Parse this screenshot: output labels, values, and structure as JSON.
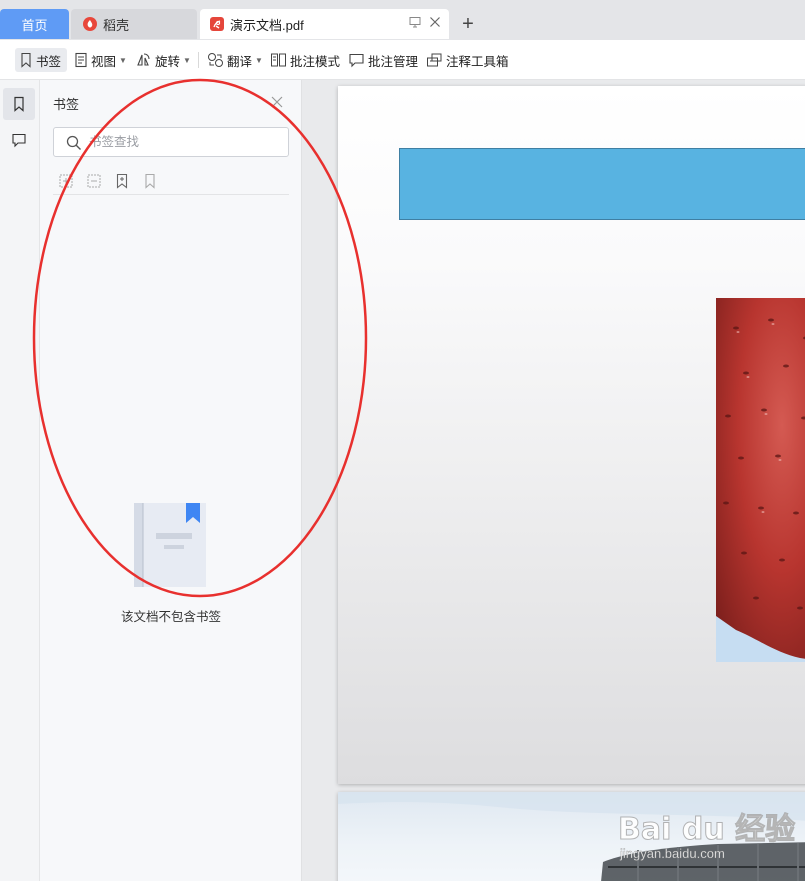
{
  "tabs": {
    "home": "首页",
    "daoke": "稻壳",
    "document": "演示文档.pdf",
    "new_tab": "+"
  },
  "toolbar": {
    "bookmark": "书签",
    "view": "视图",
    "rotate": "旋转",
    "translate": "翻译",
    "annotate_mode": "批注模式",
    "annotate_manage": "批注管理",
    "annotate_toolbox": "注释工具箱"
  },
  "panel": {
    "title": "书签",
    "search_placeholder": "书签查找",
    "empty_message": "该文档不包含书签"
  },
  "watermark": {
    "logo": "Bai du 经验",
    "url": "jingyan.baidu.com"
  },
  "colors": {
    "home_tab": "#5f9bf5",
    "annotation_ellipse": "#e8302e",
    "page_banner": "#58b3e1",
    "bookmark_ribbon": "#3f86f3"
  },
  "icons": {
    "rail": [
      "bookmark-icon",
      "comment-icon"
    ],
    "panel_tools": [
      "expand-all-icon",
      "collapse-all-icon",
      "add-bookmark-icon",
      "bookmark-outline-icon"
    ]
  }
}
